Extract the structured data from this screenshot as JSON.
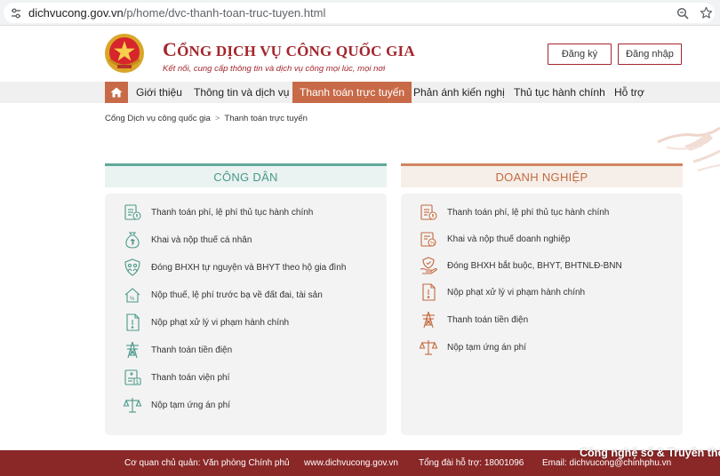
{
  "browser": {
    "url_host": "dichvucong.gov.vn",
    "url_path": "/p/home/dvc-thanh-toan-truc-tuyen.html"
  },
  "header": {
    "title_first_letter": "C",
    "title_rest": "ỔNG DỊCH VỤ CÔNG QUỐC GIA",
    "slogan": "Kết nối, cung cấp thông tin và dịch vụ công mọi lúc, mọi nơi",
    "register_label": "Đăng ký",
    "login_label": "Đăng nhập"
  },
  "nav": {
    "items": [
      {
        "label": "Giới thiệu"
      },
      {
        "label": "Thông tin và dịch vụ"
      },
      {
        "label": "Thanh toán trực tuyến"
      },
      {
        "label": "Phản ánh kiến nghị"
      },
      {
        "label": "Thủ tục hành chính"
      },
      {
        "label": "Hỗ trợ"
      }
    ]
  },
  "breadcrumb": {
    "root": "Cổng Dịch vụ công quốc gia",
    "separator": ">",
    "current": "Thanh toán trực tuyến"
  },
  "citizen": {
    "title": "CÔNG DÂN",
    "items": [
      {
        "label": "Thanh toán phí, lệ phí thủ tục hành chính",
        "icon": "fee-document-icon"
      },
      {
        "label": "Khai và nộp thuế cá nhân",
        "icon": "money-bag-icon"
      },
      {
        "label": "Đóng BHXH tự nguyện và BHYT theo hộ gia đình",
        "icon": "family-shield-icon"
      },
      {
        "label": "Nộp thuế, lệ phí trước bạ về đất đai, tài sản",
        "icon": "house-tax-icon"
      },
      {
        "label": "Nộp phạt xử lý vi phạm hành chính",
        "icon": "penalty-document-icon"
      },
      {
        "label": "Thanh toán tiền điện",
        "icon": "power-tower-icon"
      },
      {
        "label": "Thanh toán viện phí",
        "icon": "hospital-bill-icon"
      },
      {
        "label": "Nộp tạm ứng án phí",
        "icon": "scales-icon"
      }
    ]
  },
  "business": {
    "title": "DOANH NGHIỆP",
    "items": [
      {
        "label": "Thanh toán phí, lệ phí thủ tục hành chính",
        "icon": "fee-document-icon"
      },
      {
        "label": "Khai và nộp thuế doanh nghiệp",
        "icon": "business-tax-icon"
      },
      {
        "label": "Đóng BHXH bắt buộc, BHYT, BHTNLĐ-BNN",
        "icon": "hand-shield-icon"
      },
      {
        "label": "Nộp phạt xử lý vi phạm hành chính",
        "icon": "penalty-document-icon"
      },
      {
        "label": "Thanh toán tiền điện",
        "icon": "power-tower-icon"
      },
      {
        "label": "Nộp tạm ứng án phí",
        "icon": "scales-icon"
      }
    ]
  },
  "footer": {
    "agency": "Cơ quan chủ quản: Văn phòng Chính phủ",
    "website": "www.dichvucong.gov.vn",
    "hotline": "Tổng đài hỗ trợ: 18001096",
    "email": "Email: dichvucong@chinhphu.vn"
  },
  "watermark": "Công nghệ số & Truyền thông",
  "colors": {
    "brand_red": "#a4262c",
    "nav_active": "#c86a48",
    "citizen_teal": "#5ea99a",
    "business_orange": "#d08560",
    "footer_bg": "#8a2727"
  }
}
